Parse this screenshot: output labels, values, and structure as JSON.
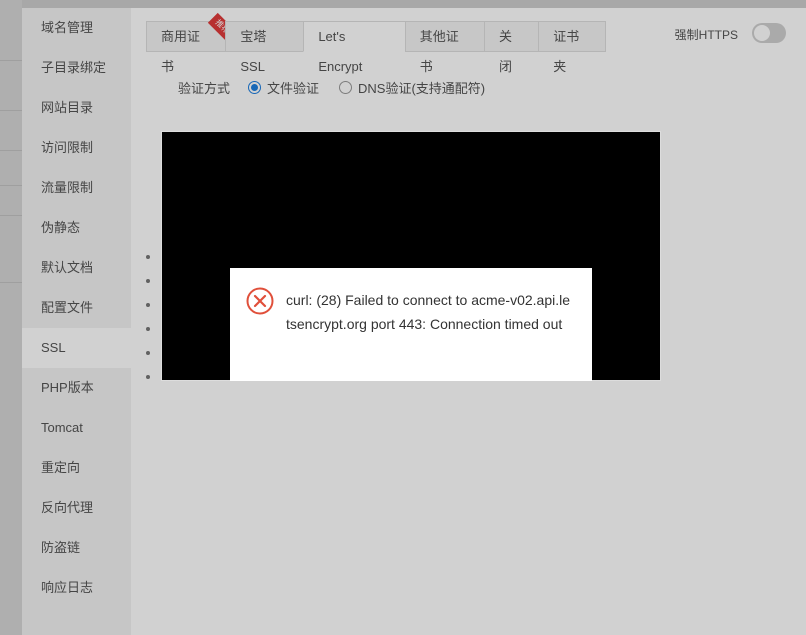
{
  "sidebar": {
    "items": [
      {
        "label": "域名管理"
      },
      {
        "label": "子目录绑定"
      },
      {
        "label": "网站目录"
      },
      {
        "label": "访问限制"
      },
      {
        "label": "流量限制"
      },
      {
        "label": "伪静态"
      },
      {
        "label": "默认文档"
      },
      {
        "label": "配置文件"
      },
      {
        "label": "SSL",
        "active": true
      },
      {
        "label": "PHP版本"
      },
      {
        "label": "Tomcat"
      },
      {
        "label": "重定向"
      },
      {
        "label": "反向代理"
      },
      {
        "label": "防盗链"
      },
      {
        "label": "响应日志"
      }
    ]
  },
  "tabs": [
    {
      "label": "商用证书",
      "ribbon": "推荐"
    },
    {
      "label": "宝塔SSL"
    },
    {
      "label": "Let's Encrypt",
      "active": true
    },
    {
      "label": "其他证书"
    },
    {
      "label": "关闭"
    },
    {
      "label": "证书夹"
    }
  ],
  "https": {
    "label": "强制HTTPS",
    "enabled": false
  },
  "verify": {
    "label": "验证方式",
    "options": [
      {
        "label": "文件验证",
        "checked": true
      },
      {
        "label": "DNS验证(支持通配符)",
        "checked": false
      }
    ]
  },
  "error": {
    "icon": "error-circle-icon",
    "message": "curl: (28) Failed to connect to acme-v02.api.letsencrypt.org port 443: Connection timed out",
    "color": "#e04f3a"
  },
  "colors": {
    "accent": "#1e7fe0",
    "ribbon": "#e03b3b"
  }
}
